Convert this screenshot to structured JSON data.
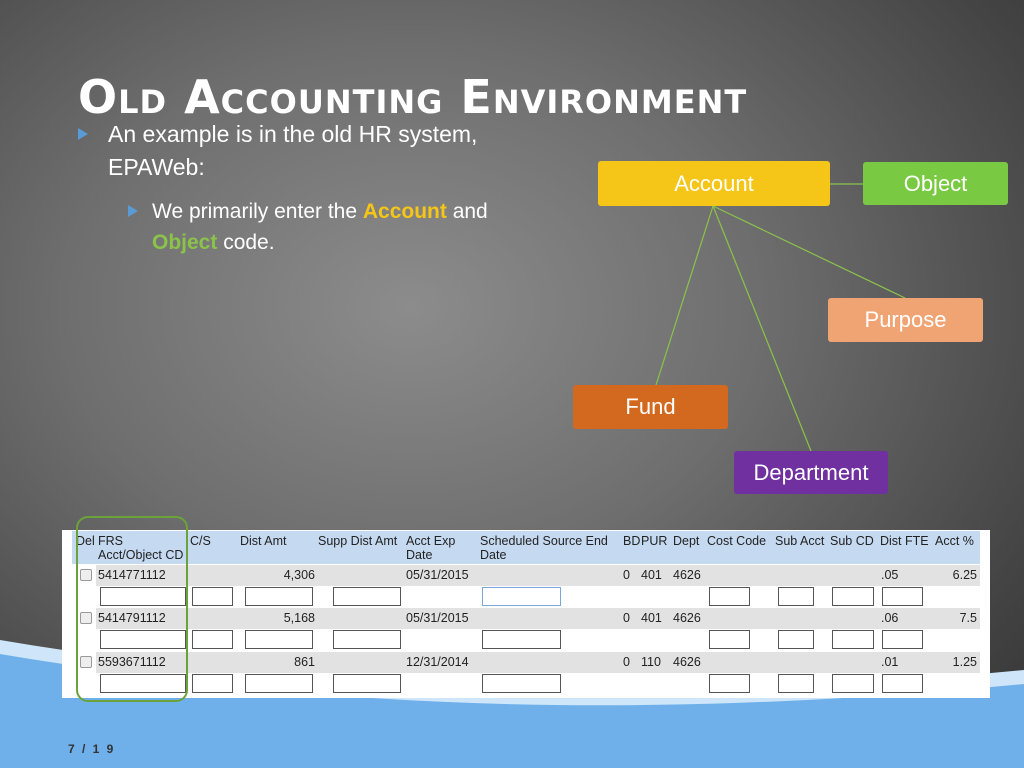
{
  "slide": {
    "title": "Old Accounting Environment",
    "bullet1": "An example is in the old HR system, EPAWeb:",
    "bullet2_pre": "We primarily enter the ",
    "bullet2_account": "Account",
    "bullet2_mid": " and ",
    "bullet2_object": "Object",
    "bullet2_post": " code.",
    "page": "7 / 1 9"
  },
  "diagram": {
    "account": "Account",
    "object": "Object",
    "purpose": "Purpose",
    "fund": "Fund",
    "department": "Department",
    "colors": {
      "account": "#f5c518",
      "object": "#7ac943",
      "purpose": "#f0a474",
      "fund": "#d2691e",
      "department": "#7030a0",
      "lines": "#8bc34a"
    }
  },
  "table": {
    "headers": [
      "Del",
      "FRS",
      "Acct/Object CD",
      "C/S",
      "Dist Amt",
      "Supp Dist Amt",
      "Acct Exp",
      "Date",
      "Scheduled Source End",
      "Date",
      "BD",
      "PUR",
      "Dept",
      "Cost Code",
      "Sub Acct",
      "Sub CD",
      "Dist FTE",
      "Acct %"
    ],
    "rows": [
      {
        "frs": "5414771112",
        "dist_amt": "4,306",
        "exp_date": "05/31/2015",
        "bd": "0",
        "pur": "401",
        "dept": "4626",
        "fte": ".05",
        "pct": "6.25"
      },
      {
        "frs": "5414791112",
        "dist_amt": "5,168",
        "exp_date": "05/31/2015",
        "bd": "0",
        "pur": "401",
        "dept": "4626",
        "fte": ".06",
        "pct": "7.5"
      },
      {
        "frs": "5593671112",
        "dist_amt": "861",
        "exp_date": "12/31/2014",
        "bd": "0",
        "pur": "110",
        "dept": "4626",
        "fte": ".01",
        "pct": "1.25"
      }
    ]
  }
}
